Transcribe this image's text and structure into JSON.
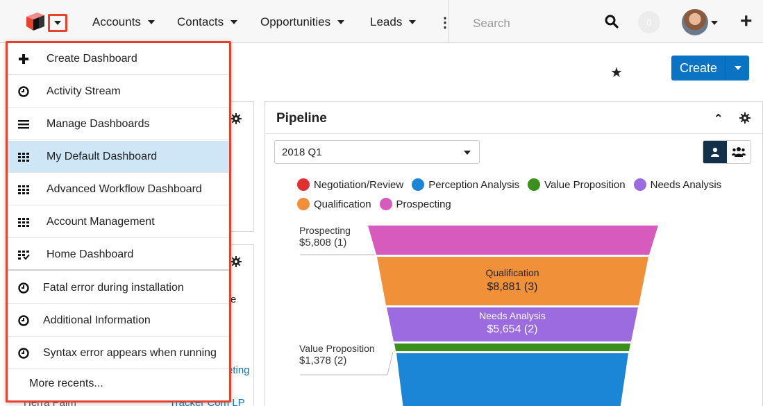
{
  "nav": {
    "items": [
      {
        "label": "Accounts"
      },
      {
        "label": "Contacts"
      },
      {
        "label": "Opportunities"
      },
      {
        "label": "Leads"
      }
    ],
    "more_glyph": "⋮",
    "search_placeholder": "Search",
    "notification_count": "0"
  },
  "menu": {
    "actions": [
      {
        "label": "Create Dashboard",
        "icon": "plus-icon"
      },
      {
        "label": "Activity Stream",
        "icon": "clock-icon"
      },
      {
        "label": "Manage Dashboards",
        "icon": "hamburger-icon"
      }
    ],
    "dashboards": [
      {
        "label": "My Default Dashboard",
        "icon": "grid-icon",
        "selected": true
      },
      {
        "label": "Advanced Workflow Dashboard",
        "icon": "grid-icon",
        "selected": false
      },
      {
        "label": "Account Management",
        "icon": "grid-icon",
        "selected": false
      },
      {
        "label": "Home Dashboard",
        "icon": "grid-check-icon",
        "selected": false
      }
    ],
    "recents": [
      {
        "label": "Fatal error during installation",
        "icon": "clock-icon"
      },
      {
        "label": "Additional Information",
        "icon": "clock-icon"
      },
      {
        "label": "Syntax error appears when running",
        "icon": "clock-icon"
      }
    ],
    "more_label": "More recents..."
  },
  "header": {
    "create_label": "Create"
  },
  "peek": {
    "text_e": "e",
    "link_eting": "eting",
    "link_lp": "Tracker Com LP",
    "text_herra": "Herra Palm"
  },
  "pipeline": {
    "title": "Pipeline",
    "period": "2018 Q1",
    "legend": [
      {
        "label": "Negotiation/Review",
        "color": "#e0302f"
      },
      {
        "label": "Perception Analysis",
        "color": "#1c86d6"
      },
      {
        "label": "Value Proposition",
        "color": "#3a8f1d"
      },
      {
        "label": "Needs Analysis",
        "color": "#9b6bdf"
      },
      {
        "label": "Qualification",
        "color": "#f0913a"
      },
      {
        "label": "Prospecting",
        "color": "#d65bbd"
      }
    ],
    "stages": {
      "prospecting": {
        "name": "Prospecting",
        "value": "$5,808 (1)",
        "color": "#d65bbd"
      },
      "qualification": {
        "name": "Qualification",
        "value": "$8,881 (3)",
        "color": "#f0913a"
      },
      "needs": {
        "name": "Needs Analysis",
        "value": "$5,654 (2)",
        "color": "#9b6bdf"
      },
      "value_prop": {
        "name": "Value Proposition",
        "value": "$1,378 (2)",
        "color": "#3a8f1d"
      },
      "perception": {
        "name": "Perception Analysis",
        "color": "#1c86d6"
      }
    }
  }
}
